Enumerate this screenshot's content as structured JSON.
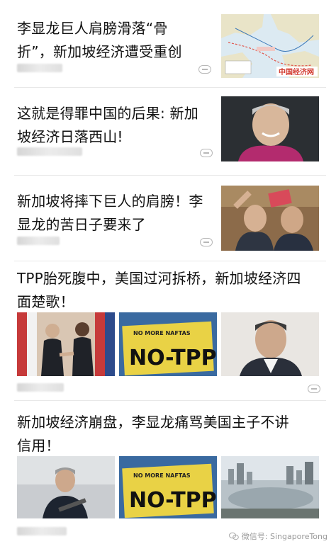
{
  "feed": {
    "items": [
      {
        "title": "李显龙巨人肩膀滑落“骨折”，新加坡经济遭受重创",
        "title_line1": "李显龙巨人肩膀滑落“骨",
        "title_line2": "折”，新加坡经济遭受重创",
        "thumb_logo": "中国经济网"
      },
      {
        "title": "这就是得罪中国的后果: 新加坡经济日落西山!",
        "title_line1": "这就是得罪中国的后果: 新加",
        "title_line2": "坡经济日落西山!"
      },
      {
        "title": "新加坡将摔下巨人的肩膀！李显龙的苦日子要来了",
        "title_line1": "新加坡将摔下巨人的肩膀！李",
        "title_line2": "显龙的苦日子要来了"
      },
      {
        "title": "TPP胎死腹中，美国过河拆桥，新加坡经济四面楚歌！",
        "title_line1": "TPP胎死腹中，美国过河拆桥，新加坡经济四",
        "title_line2": "面楚歌！",
        "sign_small": "NO MORE NAFTAS",
        "sign_big": "NO-TPP"
      },
      {
        "title": "新加坡经济崩盘，李显龙痛骂美国主子不讲信用！",
        "title_line1": "新加坡经济崩盘，李显龙痛骂美国主子不讲",
        "title_line2": "信用！",
        "sign_small": "NO MORE NAFTAS",
        "sign_big": "NO-TPP"
      }
    ]
  },
  "watermark": {
    "text": "微信号: SingaporeTong"
  }
}
